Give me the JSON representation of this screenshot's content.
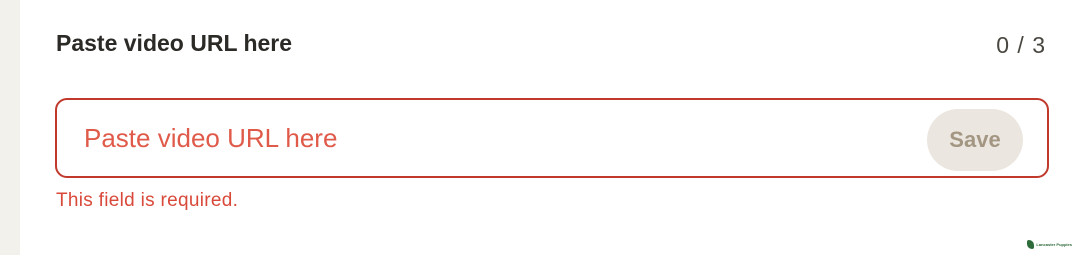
{
  "form": {
    "label": "Paste video URL here",
    "counter": "0 / 3",
    "input": {
      "value": "",
      "placeholder": "Paste video URL here"
    },
    "save_label": "Save",
    "error": "This field is required."
  },
  "brand": {
    "name": "Lancaster Puppies",
    "color": "#2e6b3a"
  },
  "colors": {
    "error": "#c0392b",
    "placeholder": "#e05a4a",
    "button_bg": "#ebe6df",
    "button_text": "#a39783"
  }
}
